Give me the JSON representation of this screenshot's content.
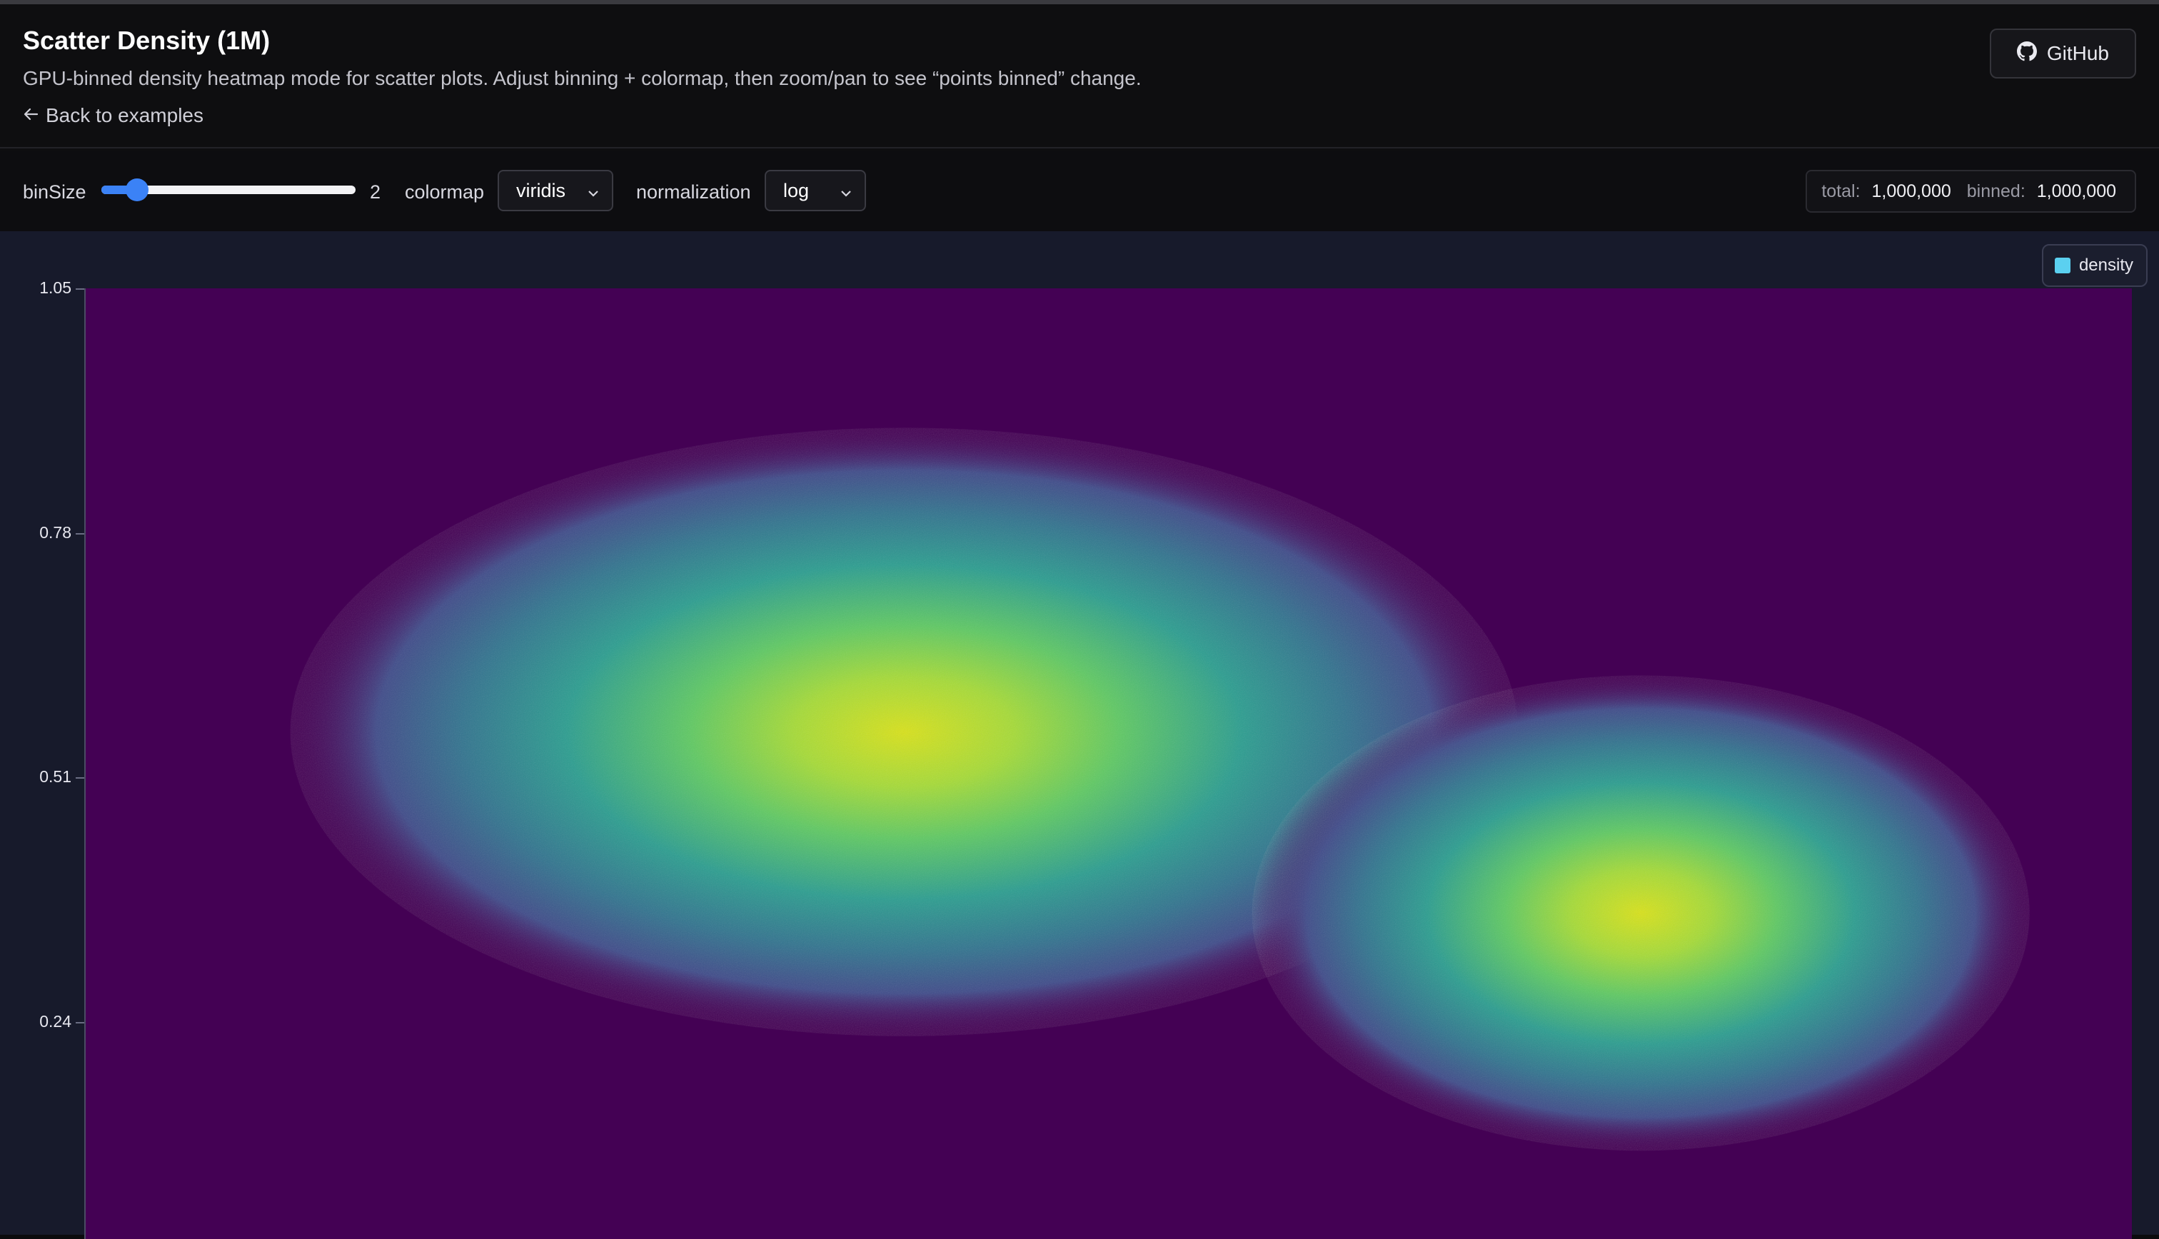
{
  "header": {
    "title": "Scatter Density (1M)",
    "subtitle": "GPU-binned density heatmap mode for scatter plots. Adjust binning + colormap, then zoom/pan to see “points binned” change.",
    "back_link": "Back to examples",
    "github_label": "GitHub"
  },
  "controls": {
    "binsize_label": "binSize",
    "binsize_value": "2",
    "binsize_fraction": 0.14,
    "colormap_label": "colormap",
    "colormap_value": "viridis",
    "normalization_label": "normalization",
    "normalization_value": "log"
  },
  "stats": {
    "total_label": "total:",
    "total_value": "1,000,000",
    "binned_label": "binned:",
    "binned_value": "1,000,000"
  },
  "legend": {
    "label": "density",
    "color": "#5bd0f0"
  },
  "colors": {
    "accent": "#3b82f6",
    "plot_background": "#440154",
    "panel_background": "#171a2b"
  },
  "chart_data": {
    "type": "heatmap",
    "title": "",
    "xlabel": "",
    "ylabel": "",
    "colormap": "viridis",
    "normalization": "log",
    "y_ticks": [
      "1.05",
      "0.78",
      "0.51",
      "0.24"
    ],
    "ylim": [
      0.0,
      1.05
    ],
    "series": [
      {
        "name": "density",
        "clusters": [
          {
            "center_x": 0.4,
            "center_y": 0.56,
            "peak": "high"
          },
          {
            "center_x": 0.76,
            "center_y": 0.36,
            "peak": "high"
          }
        ]
      }
    ],
    "legend_position": "top-right",
    "grid": false
  }
}
